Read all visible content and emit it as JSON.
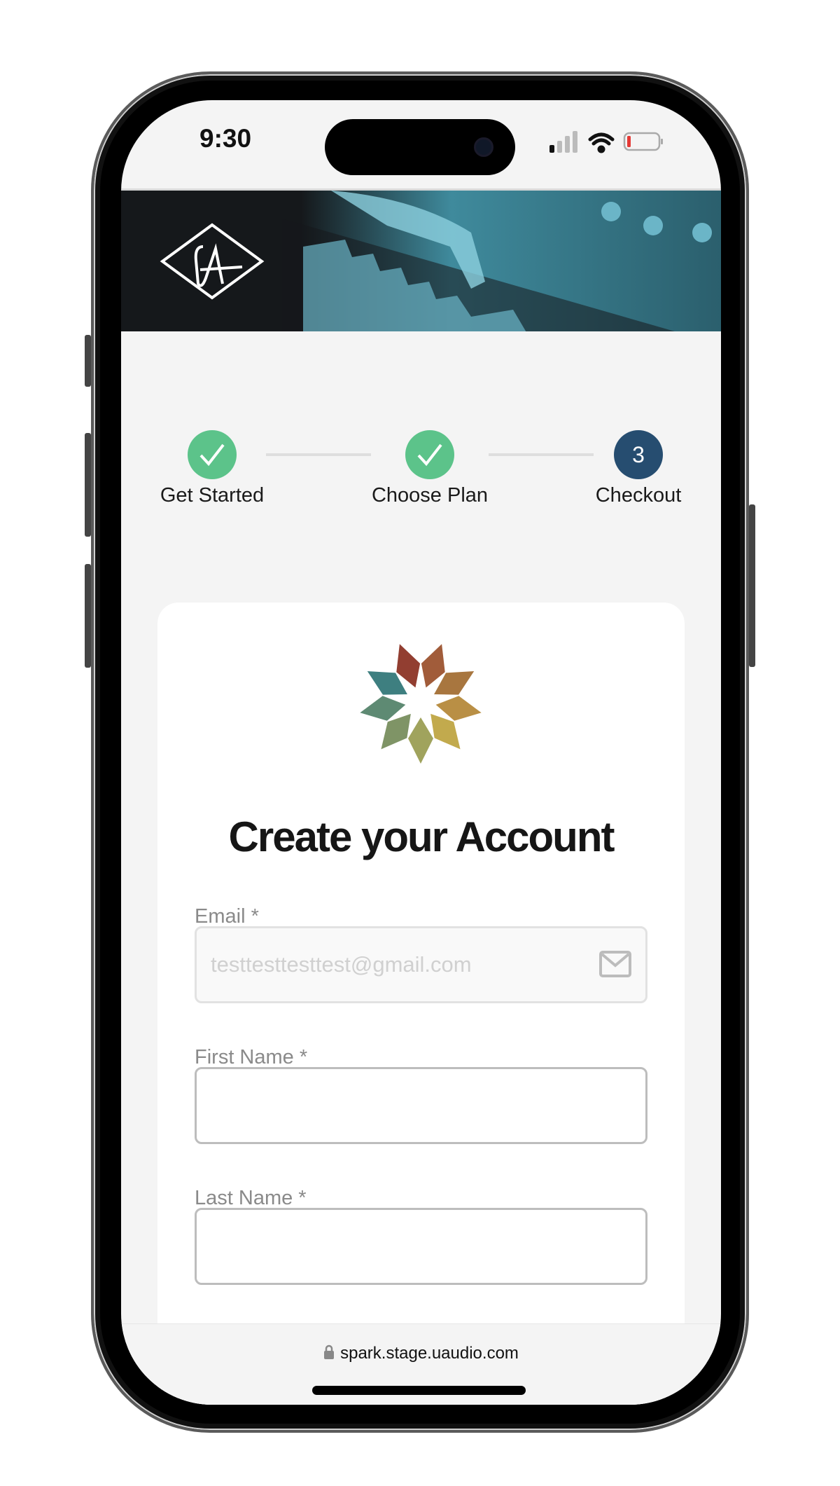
{
  "status_bar": {
    "time": "9:30",
    "battery_color": "#e53935"
  },
  "brand": {
    "logo_text": "UA"
  },
  "steps": [
    {
      "label": "Get Started",
      "state": "complete",
      "icon": "check-icon"
    },
    {
      "label": "Choose Plan",
      "state": "complete",
      "icon": "check-icon"
    },
    {
      "label": "Checkout",
      "state": "current",
      "number": "3"
    }
  ],
  "colors": {
    "complete": "#5cc38a",
    "current": "#264d70",
    "star": [
      "#923e31",
      "#a15c3a",
      "#a8763f",
      "#b98f45",
      "#c2aa4d",
      "#a0a35d",
      "#7f9466",
      "#5e8a73",
      "#3e7f80"
    ]
  },
  "form": {
    "title": "Create your Account",
    "email": {
      "label": "Email *",
      "value": "testtesttesttest@gmail.com",
      "icon": "mail-icon"
    },
    "first_name": {
      "label": "First Name *",
      "value": ""
    },
    "last_name": {
      "label": "Last Name *",
      "value": ""
    }
  },
  "browser": {
    "url": "spark.stage.uaudio.com",
    "icon": "lock-icon"
  }
}
